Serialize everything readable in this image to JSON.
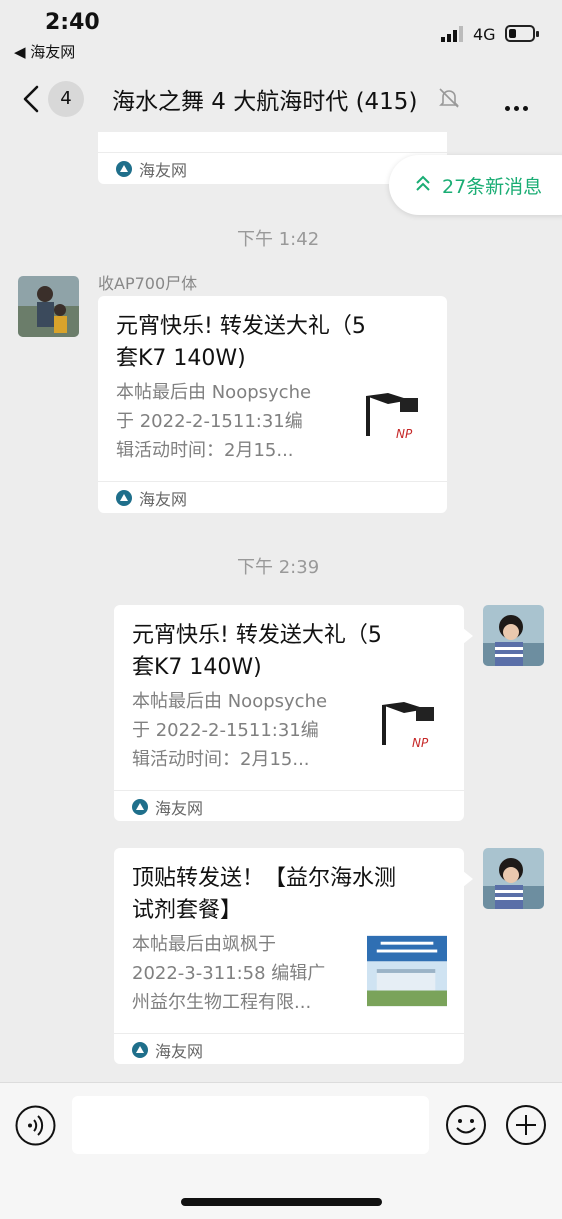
{
  "status_bar": {
    "time": "2:40",
    "back_app": "◀ 海友网",
    "network": "4G"
  },
  "nav": {
    "back_badge": "4",
    "title": "海水之舞 4 大航海时代 (415)"
  },
  "new_messages": {
    "label": "27条新消息"
  },
  "messages": [
    {
      "footer": "海友网"
    },
    {
      "time": "下午 1:42"
    },
    {
      "sender": "收AP700尸体",
      "title_line1": "元宵快乐! 转发送大礼（5",
      "title_line2": "套K7  140W)",
      "desc_line1": "本帖最后由 Noopsyche",
      "desc_line2": "于 2022-2-1511:31编",
      "desc_line3": "辑活动时间：2月15...",
      "footer": "海友网"
    },
    {
      "time": "下午 2:39"
    },
    {
      "title_line1": "元宵快乐! 转发送大礼（5",
      "title_line2": "套K7  140W)",
      "desc_line1": "本帖最后由 Noopsyche",
      "desc_line2": "于 2022-2-1511:31编",
      "desc_line3": "辑活动时间：2月15...",
      "footer": "海友网"
    },
    {
      "title_line1": "顶贴转发送！【益尔海水测",
      "title_line2": "试剂套餐】",
      "desc_line1": "本帖最后由飒枫于",
      "desc_line2": "2022-3-311:58 编辑广",
      "desc_line3": "州益尔生物工程有限...",
      "footer": "海友网"
    }
  ],
  "colors": {
    "accent_green": "#1aad74",
    "background": "#ededed",
    "card": "#ffffff"
  },
  "icons": [
    "back-chevron-icon",
    "mute-bell-icon",
    "more-icon",
    "double-chevron-up-icon",
    "voice-icon",
    "emoji-icon",
    "plus-icon",
    "site-logo-icon"
  ]
}
